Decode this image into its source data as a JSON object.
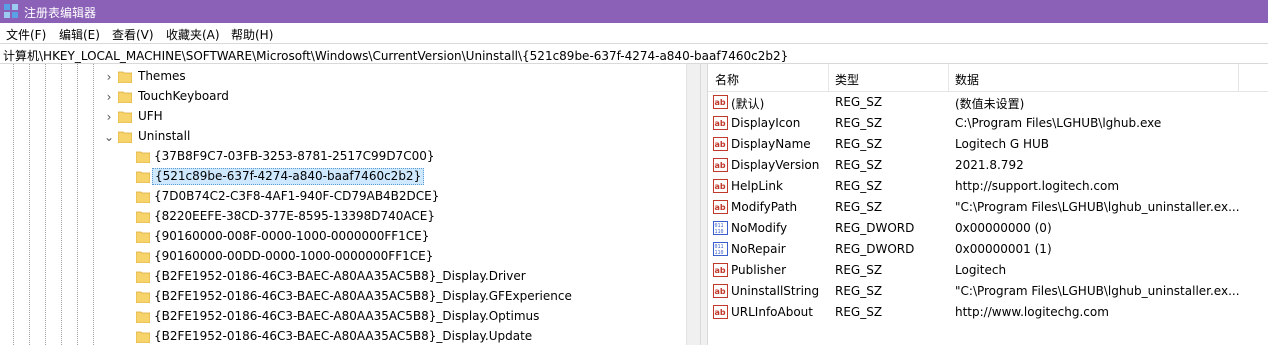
{
  "window": {
    "title": "注册表编辑器"
  },
  "menu": [
    {
      "label": "文件(F)"
    },
    {
      "label": "编辑(E)"
    },
    {
      "label": "查看(V)"
    },
    {
      "label": "收藏夹(A)"
    },
    {
      "label": "帮助(H)"
    }
  ],
  "address": {
    "path": "计算机\\HKEY_LOCAL_MACHINE\\SOFTWARE\\Microsoft\\Windows\\CurrentVersion\\Uninstall\\{521c89be-637f-4274-a840-baaf7460c2b2}"
  },
  "tree": {
    "nodes": [
      {
        "label": "Themes",
        "expander": "collapsed",
        "selected": false
      },
      {
        "label": "TouchKeyboard",
        "expander": "collapsed",
        "selected": false
      },
      {
        "label": "UFH",
        "expander": "collapsed",
        "selected": false
      },
      {
        "label": "Uninstall",
        "expander": "expanded",
        "selected": false
      },
      {
        "label": "{37B8F9C7-03FB-3253-8781-2517C99D7C00}",
        "expander": "none",
        "selected": false
      },
      {
        "label": "{521c89be-637f-4274-a840-baaf7460c2b2}",
        "expander": "none",
        "selected": true
      },
      {
        "label": "{7D0B74C2-C3F8-4AF1-940F-CD79AB4B2DCE}",
        "expander": "none",
        "selected": false
      },
      {
        "label": "{8220EEFE-38CD-377E-8595-13398D740ACE}",
        "expander": "none",
        "selected": false
      },
      {
        "label": "{90160000-008F-0000-1000-0000000FF1CE}",
        "expander": "none",
        "selected": false
      },
      {
        "label": "{90160000-00DD-0000-1000-0000000FF1CE}",
        "expander": "none",
        "selected": false
      },
      {
        "label": "{B2FE1952-0186-46C3-BAEC-A80AA35AC5B8}_Display.Driver",
        "expander": "none",
        "selected": false
      },
      {
        "label": "{B2FE1952-0186-46C3-BAEC-A80AA35AC5B8}_Display.GFExperience",
        "expander": "none",
        "selected": false
      },
      {
        "label": "{B2FE1952-0186-46C3-BAEC-A80AA35AC5B8}_Display.Optimus",
        "expander": "none",
        "selected": false
      },
      {
        "label": "{B2FE1952-0186-46C3-BAEC-A80AA35AC5B8}_Display.Update",
        "expander": "none",
        "selected": false
      }
    ]
  },
  "values": {
    "columns": {
      "name": "名称",
      "type": "类型",
      "data": "数据"
    },
    "rows": [
      {
        "icon": "string-value-icon",
        "name": "(默认)",
        "type": "REG_SZ",
        "data": "(数值未设置)"
      },
      {
        "icon": "string-value-icon",
        "name": "DisplayIcon",
        "type": "REG_SZ",
        "data": "C:\\Program Files\\LGHUB\\lghub.exe"
      },
      {
        "icon": "string-value-icon",
        "name": "DisplayName",
        "type": "REG_SZ",
        "data": "Logitech G HUB"
      },
      {
        "icon": "string-value-icon",
        "name": "DisplayVersion",
        "type": "REG_SZ",
        "data": "2021.8.792"
      },
      {
        "icon": "string-value-icon",
        "name": "HelpLink",
        "type": "REG_SZ",
        "data": "http://support.logitech.com"
      },
      {
        "icon": "string-value-icon",
        "name": "ModifyPath",
        "type": "REG_SZ",
        "data": "\"C:\\Program Files\\LGHUB\\lghub_uninstaller.ex..."
      },
      {
        "icon": "binary-value-icon",
        "name": "NoModify",
        "type": "REG_DWORD",
        "data": "0x00000000 (0)"
      },
      {
        "icon": "binary-value-icon",
        "name": "NoRepair",
        "type": "REG_DWORD",
        "data": "0x00000001 (1)"
      },
      {
        "icon": "string-value-icon",
        "name": "Publisher",
        "type": "REG_SZ",
        "data": "Logitech"
      },
      {
        "icon": "string-value-icon",
        "name": "UninstallString",
        "type": "REG_SZ",
        "data": "\"C:\\Program Files\\LGHUB\\lghub_uninstaller.ex..."
      },
      {
        "icon": "string-value-icon",
        "name": "URLInfoAbout",
        "type": "REG_SZ",
        "data": "http://www.logitechg.com"
      }
    ]
  },
  "colors": {
    "titlebar": "#8b61b8",
    "selection": "#cde8ff",
    "folder": "#f7d46b"
  }
}
